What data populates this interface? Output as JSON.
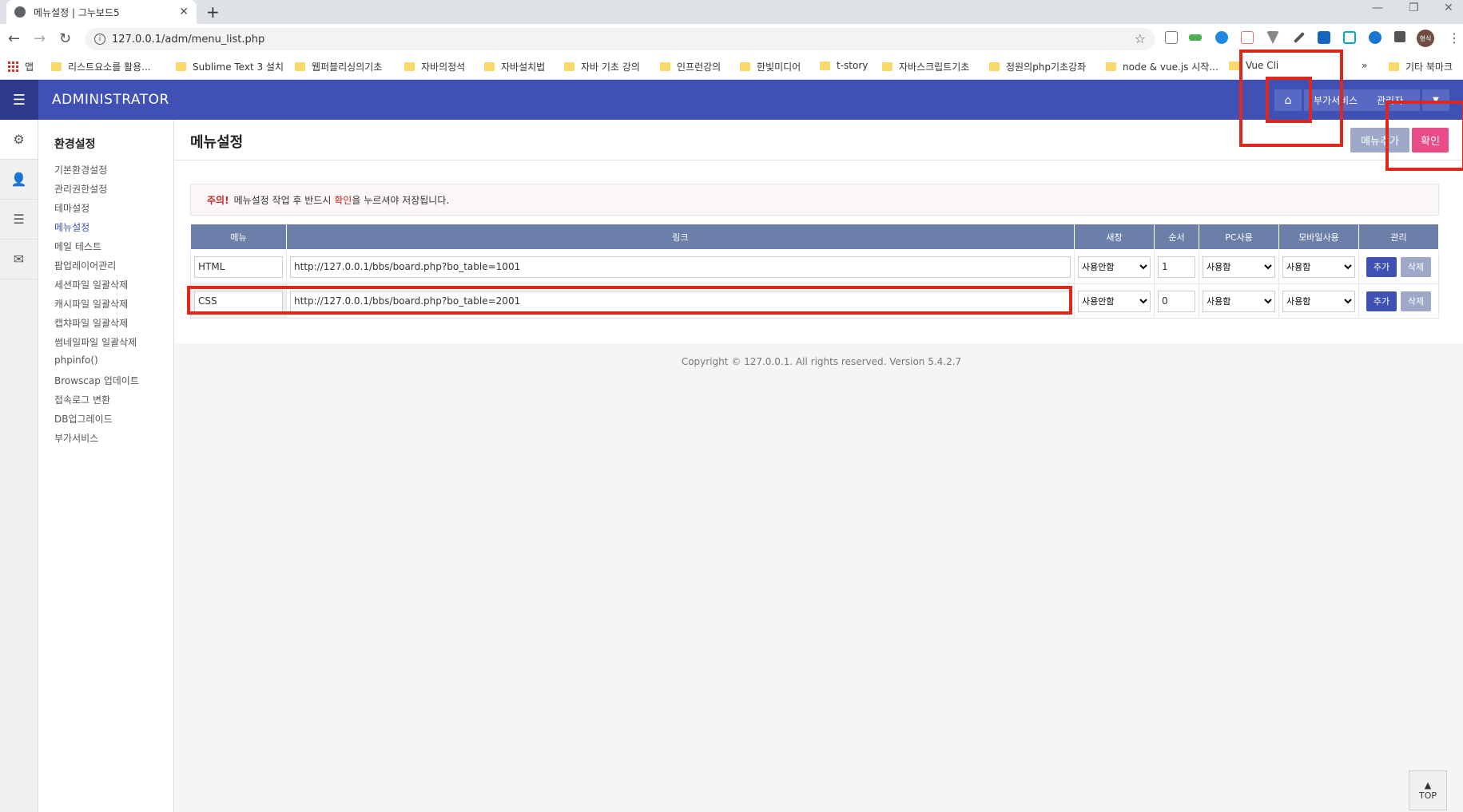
{
  "browser": {
    "tab_title": "메뉴설정 | 그누보드5",
    "url": "127.0.0.1/adm/menu_list.php",
    "bookmarks": [
      "앱",
      "리스트요소를 활용...",
      "Sublime Text 3 설치",
      "웹퍼블리싱의기초",
      "자바의정석",
      "자바설치법",
      "자바 기초 강의",
      "인프런강의",
      "한빛미디어",
      "t-story",
      "자바스크립트기초",
      "정원의php기초강좌",
      "node & vue.js 시작...",
      "Vue Cli",
      "»",
      "기타 북마크"
    ],
    "profile_label": "형식"
  },
  "header": {
    "brand": "ADMINISTRATOR",
    "addon_services": "부가서비스",
    "admin": "관리자"
  },
  "sidebar": {
    "title": "환경설정",
    "items": [
      "기본환경설정",
      "관리권한설정",
      "테마설정",
      "메뉴설정",
      "메일 테스트",
      "팝업레이어관리",
      "세션파일 일괄삭제",
      "캐시파일 일괄삭제",
      "캡챠파일 일괄삭제",
      "썸네일파일 일괄삭제",
      "phpinfo()",
      "Browscap 업데이트",
      "접속로그 변환",
      "DB업그레이드",
      "부가서비스"
    ],
    "active_index": 3
  },
  "page": {
    "title": "메뉴설정",
    "menu_add_label": "메뉴추가",
    "confirm_label": "확인",
    "notice_warn": "주의!",
    "notice_part1": "메뉴설정 작업 후 반드시",
    "notice_highlight": "확인",
    "notice_part2": "을 누르셔야 저장됩니다."
  },
  "table": {
    "headers": [
      "메뉴",
      "링크",
      "새창",
      "순서",
      "PC사용",
      "모바일사용",
      "관리"
    ],
    "rows": [
      {
        "menu": "HTML",
        "link": "http://127.0.0.1/bbs/board.php?bo_table=1001",
        "new_window": "사용안함",
        "order": "1",
        "pc": "사용함",
        "mobile": "사용함"
      },
      {
        "menu": "CSS",
        "link": "http://127.0.0.1/bbs/board.php?bo_table=2001",
        "new_window": "사용안함",
        "order": "0",
        "pc": "사용함",
        "mobile": "사용함"
      }
    ],
    "add_label": "추가",
    "delete_label": "삭제"
  },
  "footer": {
    "copyright": "Copyright © 127.0.0.1. All rights reserved. Version 5.4.2.7",
    "top_label": "TOP"
  }
}
